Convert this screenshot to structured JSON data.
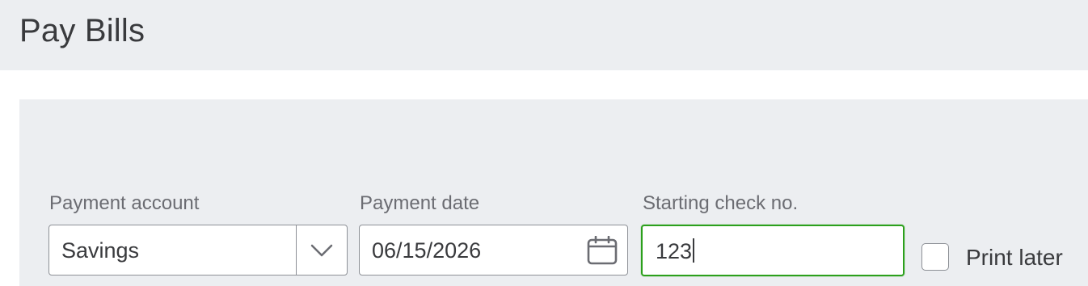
{
  "page": {
    "title": "Pay Bills"
  },
  "form": {
    "payment_account": {
      "label": "Payment account",
      "value": "Savings",
      "icon": "chevron-down-icon"
    },
    "payment_date": {
      "label": "Payment date",
      "value": "06/15/2026",
      "icon": "calendar-icon"
    },
    "starting_check_no": {
      "label": "Starting check no.",
      "value": "123",
      "focused": true
    },
    "print_later": {
      "label": "Print later",
      "checked": false
    }
  },
  "colors": {
    "header_bg": "#eceef1",
    "panel_bg": "#eceef1",
    "focus_border": "#2ca01c",
    "text": "#393a3d",
    "label_text": "#6b6c72",
    "border": "#8d9096"
  }
}
